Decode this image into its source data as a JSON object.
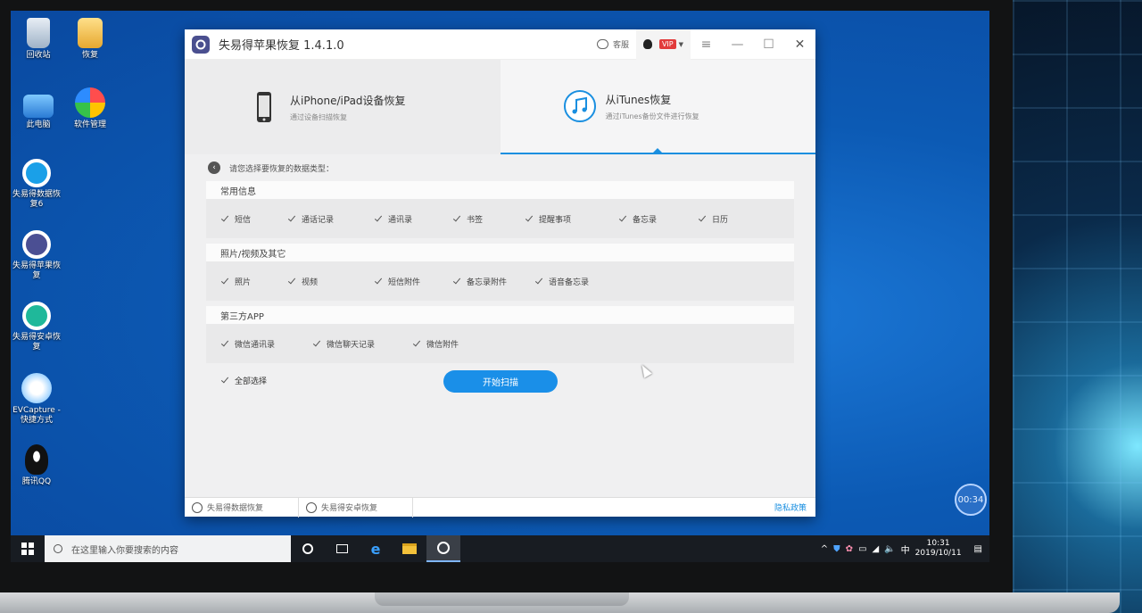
{
  "desktop": {
    "icons": [
      {
        "label": "回收站",
        "name": "recycle-bin-icon"
      },
      {
        "label": "恢复",
        "name": "folder-icon"
      },
      {
        "label": "此电脑",
        "name": "computer-icon"
      },
      {
        "label": "软件管理",
        "name": "software-manager-icon"
      },
      {
        "label": "失易得数据恢复6",
        "name": "data-recovery-app-icon"
      },
      {
        "label": "失易得苹果恢复",
        "name": "apple-recovery-app-icon"
      },
      {
        "label": "失易得安卓恢复",
        "name": "android-recovery-app-icon"
      },
      {
        "label": "EVCapture - 快捷方式",
        "name": "evcapture-icon"
      },
      {
        "label": "腾讯QQ",
        "name": "qq-icon"
      }
    ]
  },
  "app": {
    "title": "失易得苹果恢复  1.4.1.0",
    "support_label": "客服",
    "vip_label": "VIP",
    "tabs": [
      {
        "title": "从iPhone/iPad设备恢复",
        "subtitle": "通过设备扫描恢复"
      },
      {
        "title": "从iTunes恢复",
        "subtitle": "通过iTunes备份文件进行恢复"
      }
    ],
    "prompt": "请您选择要恢复的数据类型：",
    "sections": [
      {
        "title": "常用信息",
        "options": [
          "短信",
          "通话记录",
          "通讯录",
          "书签",
          "提醒事项",
          "备忘录",
          "日历"
        ]
      },
      {
        "title": "照片/视频及其它",
        "options": [
          "照片",
          "视频",
          "短信附件",
          "备忘录附件",
          "语音备忘录"
        ]
      },
      {
        "title": "第三方APP",
        "options": [
          "微信通讯录",
          "微信聊天记录",
          "微信附件"
        ]
      }
    ],
    "select_all": "全部选择",
    "scan_button": "开始扫描",
    "footer": {
      "item1": "失易得数据恢复",
      "item2": "失易得安卓恢复",
      "privacy": "隐私政策"
    }
  },
  "taskbar": {
    "search_placeholder": "在这里输入你要搜索的内容",
    "ime": "中",
    "time": "10:31",
    "date": "2019/10/11"
  },
  "overlay_timer": "00:34"
}
